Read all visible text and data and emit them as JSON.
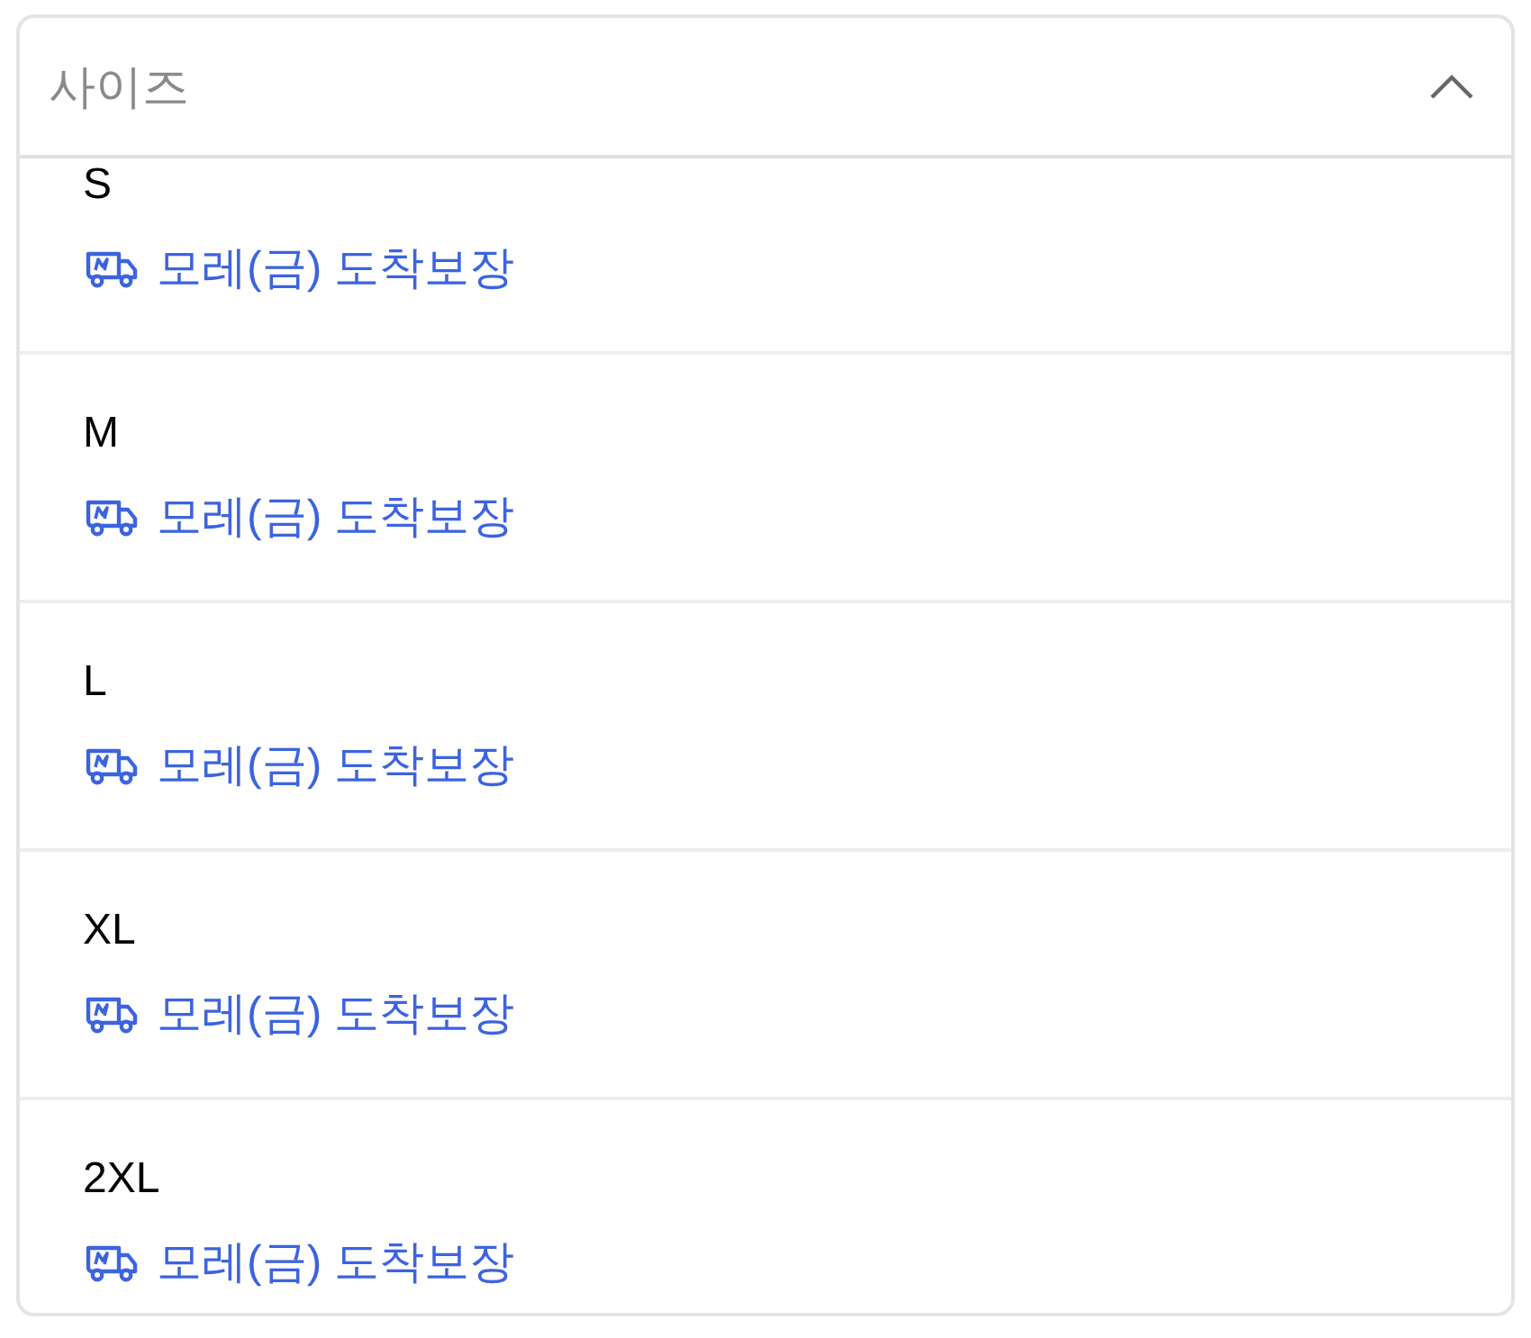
{
  "dropdown": {
    "placeholder": "사이즈",
    "expanded": true
  },
  "options": [
    {
      "size": "S",
      "delivery": "모레(금) 도착보장"
    },
    {
      "size": "M",
      "delivery": "모레(금) 도착보장"
    },
    {
      "size": "L",
      "delivery": "모레(금) 도착보장"
    },
    {
      "size": "XL",
      "delivery": "모레(금) 도착보장"
    },
    {
      "size": "2XL",
      "delivery": "모레(금) 도착보장"
    }
  ]
}
